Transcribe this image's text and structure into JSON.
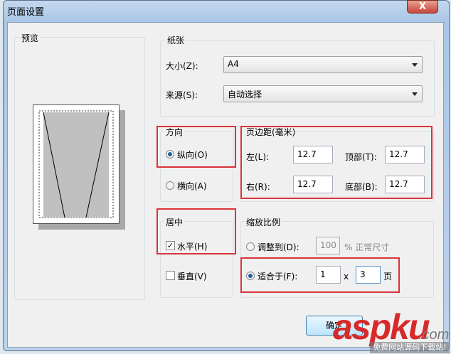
{
  "dialog": {
    "title": "页面设置",
    "close_label": "X"
  },
  "preview": {
    "label": "预览"
  },
  "paper": {
    "label": "纸张",
    "size_label": "大小(Z):",
    "size_value": "A4",
    "source_label": "来源(S):",
    "source_value": "自动选择"
  },
  "orientation": {
    "label": "方向",
    "portrait": "纵向(O)",
    "landscape": "横向(A)",
    "selected": "portrait"
  },
  "margins": {
    "label": "页边距(毫米)",
    "left_label": "左(L):",
    "left": "12.7",
    "top_label": "顶部(T):",
    "top": "12.7",
    "right_label": "右(R):",
    "right": "12.7",
    "bottom_label": "底部(B):",
    "bottom": "12.7"
  },
  "center": {
    "label": "居中",
    "horizontal": "水平(H)",
    "horizontal_checked": true,
    "vertical": "垂直(V)",
    "vertical_checked": false
  },
  "scale": {
    "label": "缩放比例",
    "adjust_label": "调整到(D):",
    "adjust_value": "100",
    "adjust_suffix": "% 正常尺寸",
    "fit_label": "适合于(F):",
    "fit_wide": "1",
    "fit_x": "x",
    "fit_tall": "3",
    "fit_suffix": "页"
  },
  "buttons": {
    "ok": "确定"
  },
  "watermark": {
    "brand": "aspku",
    "domain": ".com",
    "tagline": "免费网站源码下载站!"
  },
  "colors": {
    "highlight": "#d9343a",
    "watermark": "#d62a2a"
  }
}
